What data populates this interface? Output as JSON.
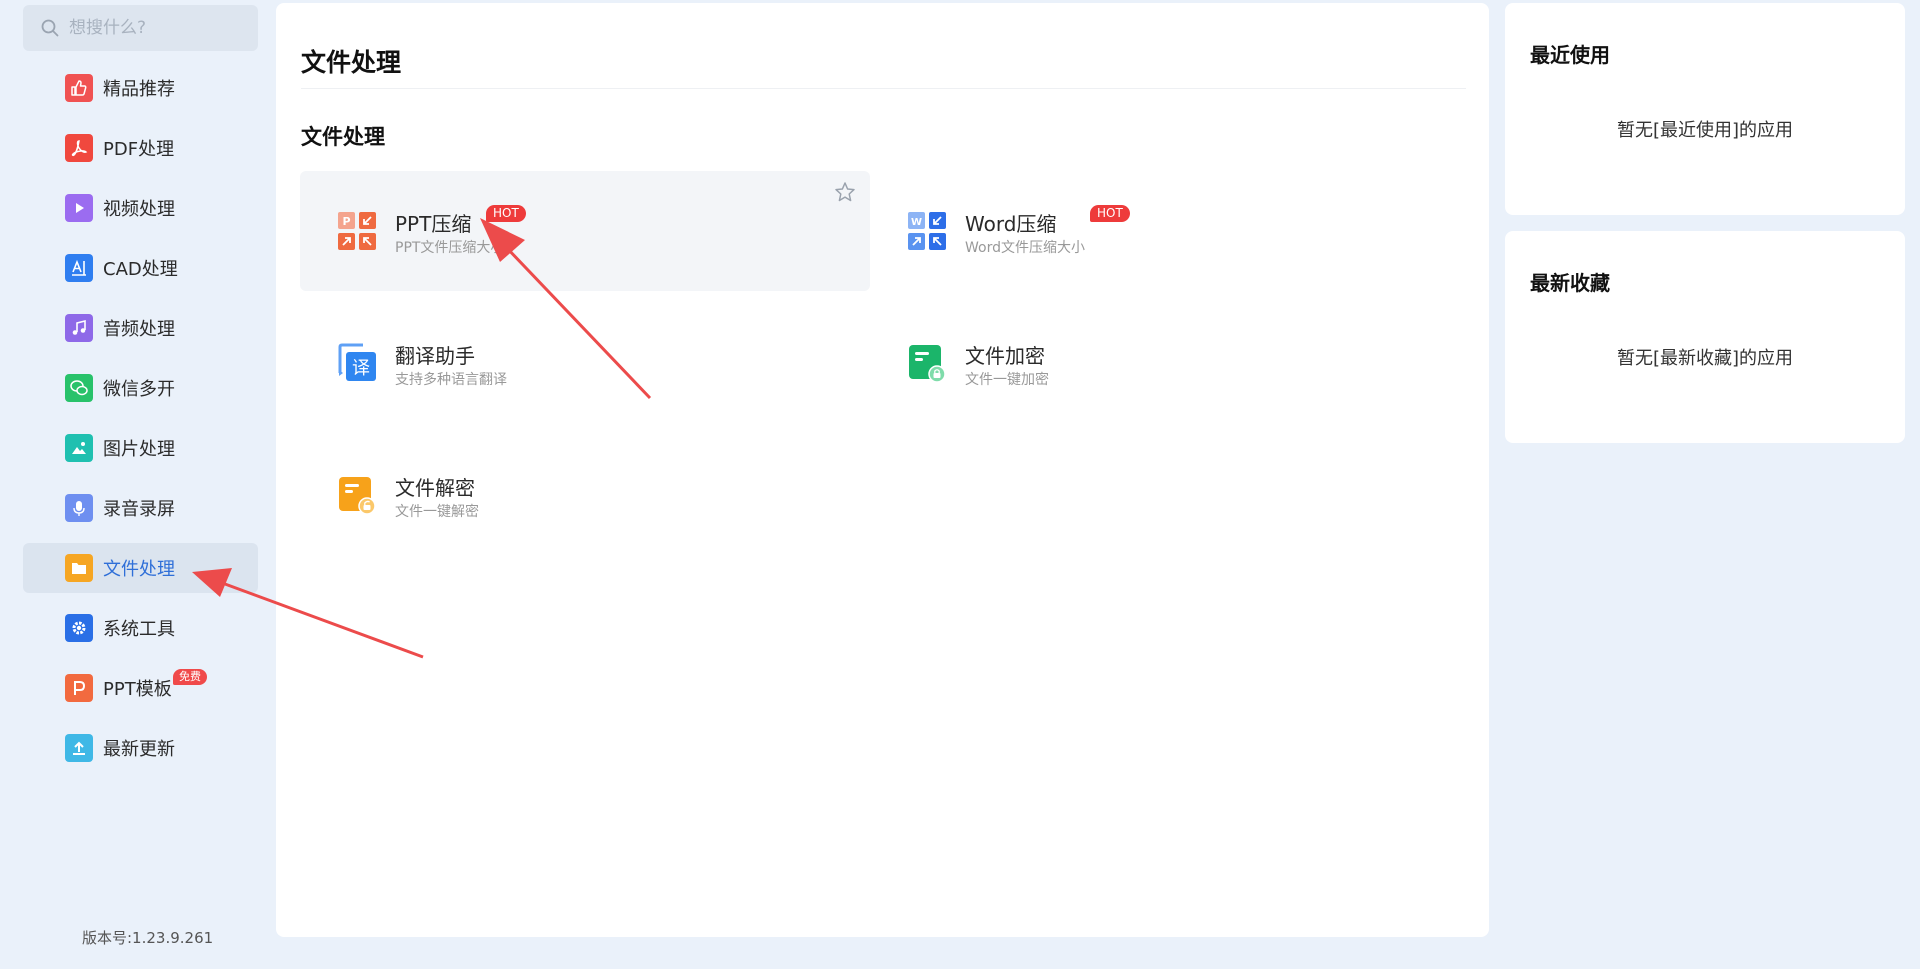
{
  "search": {
    "placeholder": "想搜什么?"
  },
  "sidebar": {
    "items": [
      {
        "label": "精品推荐",
        "icon": "thumbs-up-icon",
        "color": "#f05252"
      },
      {
        "label": "PDF处理",
        "icon": "pdf-icon",
        "color": "#f0483e"
      },
      {
        "label": "视频处理",
        "icon": "play-icon",
        "color": "#9b6cf0"
      },
      {
        "label": "CAD处理",
        "icon": "cad-icon",
        "color": "#2f7ef0"
      },
      {
        "label": "音频处理",
        "icon": "music-note-icon",
        "color": "#8e69e8"
      },
      {
        "label": "微信多开",
        "icon": "wechat-icon",
        "color": "#28c26a"
      },
      {
        "label": "图片处理",
        "icon": "image-icon",
        "color": "#1fc0b0"
      },
      {
        "label": "录音录屏",
        "icon": "microphone-icon",
        "color": "#6e8ff0"
      },
      {
        "label": "文件处理",
        "icon": "folder-icon",
        "color": "#f6a623"
      },
      {
        "label": "系统工具",
        "icon": "gear-icon",
        "color": "#2a6fe6"
      },
      {
        "label": "PPT模板",
        "icon": "ppt-template-icon",
        "color": "#f26a3f",
        "badge": "免费"
      },
      {
        "label": "最新更新",
        "icon": "upload-icon",
        "color": "#3fb8e6"
      }
    ],
    "active_item": "文件处理",
    "version": "版本号:1.23.9.261"
  },
  "main": {
    "title": "文件处理",
    "section_title": "文件处理",
    "tools": [
      {
        "name": "PPT压缩",
        "desc": "PPT文件压缩大小",
        "badge": "HOT",
        "icon": "ppt-compress-icon"
      },
      {
        "name": "Word压缩",
        "desc": "Word文件压缩大小",
        "badge": "HOT",
        "icon": "word-compress-icon"
      },
      {
        "name": "翻译助手",
        "desc": "支持多种语言翻译",
        "icon": "translate-icon"
      },
      {
        "name": "文件加密",
        "desc": "文件一键加密",
        "icon": "file-encrypt-icon"
      },
      {
        "name": "文件解密",
        "desc": "文件一键解密",
        "icon": "file-decrypt-icon"
      }
    ]
  },
  "recent": {
    "title": "最近使用",
    "empty": "暂无[最近使用]的应用"
  },
  "favorites": {
    "title": "最新收藏",
    "empty": "暂无[最新收藏]的应用"
  },
  "colors": {
    "accent": "#2f6fd8",
    "hot": "#ee3b3b",
    "annotation_arrow": "#ec4b4b"
  }
}
